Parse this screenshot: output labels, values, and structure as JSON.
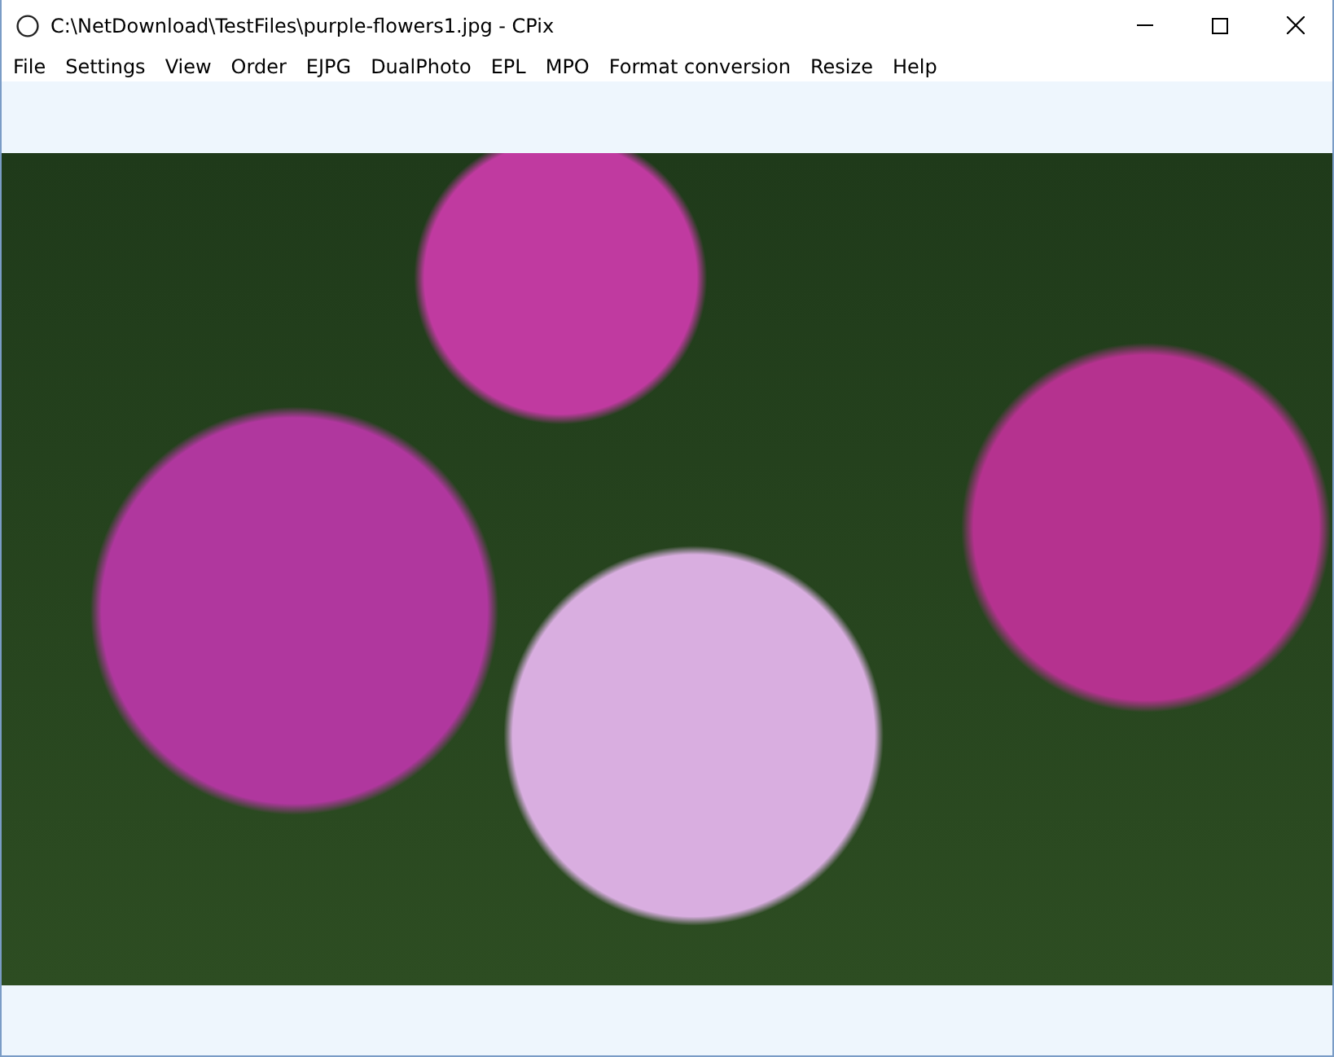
{
  "window": {
    "title": "C:\\NetDownload\\TestFiles\\purple-flowers1.jpg - CPix"
  },
  "menu": [
    "File",
    "Settings",
    "View",
    "Order",
    "EJPG",
    "DualPhoto",
    "EPL",
    "MPO",
    "Format conversion",
    "Resize",
    "Help"
  ]
}
